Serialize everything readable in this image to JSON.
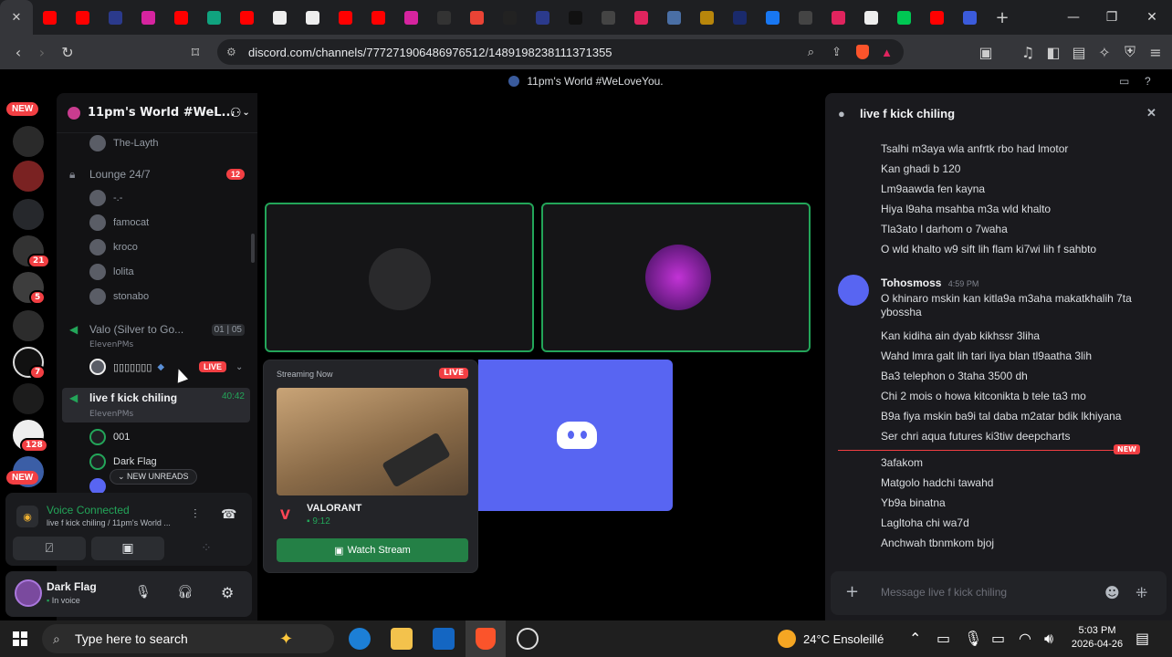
{
  "browser": {
    "url": "discord.com/channels/777271906486976512/1489198238111371355",
    "tab_count_icons": [
      "youtube-icon",
      "youtube-icon",
      "app-icon",
      "instagram-icon",
      "youtube-icon",
      "chatgpt-icon",
      "youtube-icon",
      "tiktok-icon",
      "play-icon",
      "youtube-icon",
      "youtube-icon",
      "instagram-icon",
      "app-icon",
      "gmail-icon",
      "app-icon",
      "app-icon",
      "x-icon",
      "app-icon",
      "app-icon",
      "app-icon",
      "app-icon",
      "app-icon",
      "facebook-icon",
      "app-icon",
      "app-icon",
      "app-icon",
      "app-icon",
      "youtube-icon",
      "app-icon"
    ]
  },
  "discord": {
    "window_title": "11pm's World #WeLoveYou.",
    "rail": {
      "new_top": "NEW",
      "new_bottom": "NEW",
      "badge_21": "21",
      "badge_5": "5",
      "badge_7": "7",
      "badge_128": "128"
    },
    "server_name": "11pm's World #WeL...",
    "channels": {
      "the_layth": "The-Layth",
      "lounge": "Lounge 24/7",
      "lounge_badge": "12",
      "lounge_members": [
        "-.-",
        "famocat",
        "kroco",
        "lolita",
        "stonabo"
      ],
      "valo": "Valo (Silver to Go...",
      "valo_count_a": "01",
      "valo_count_b": "05",
      "valo_sub": "ElevenPMs",
      "valo_member": "▯▯▯▯▯▯▯",
      "live_badge": "LIVE",
      "live_channel": "live f kick chiling",
      "live_time": "40:42",
      "live_sub": "ElevenPMs",
      "live_members": [
        "001",
        "Dark Flag"
      ],
      "new_unreads": "NEW UNREADS"
    },
    "voice": {
      "status": "Voice Connected",
      "detail": "live f kick chiling / 11pm's World ..."
    },
    "user": {
      "name": "Dark Flag",
      "status": "In voice"
    },
    "popup": {
      "header": "Streaming Now",
      "live": "LIVE",
      "game": "VALORANT",
      "time": "9:12",
      "button": "Watch Stream"
    },
    "chat": {
      "title": "live f kick chiling",
      "messages_a": [
        "Tsalhi m3aya wla anfrtk rbo had lmotor",
        "Kan ghadi b 120",
        "Lm9aawda fen kayna",
        "Hiya l9aha msahba m3a wld khalto",
        "Tla3ato l darhom o 7waha",
        "O wld khalto w9 sift lih flam ki7wi lih f sahbto"
      ],
      "author": "Tohosmoss",
      "time": "4:59 PM",
      "messages_b": [
        "O khinaro mskin kan kitla9a m3aha makatkhalih 7ta ybossha",
        "Kan kidiha ain dyab kikhssr 3liha",
        "Wahd lmra galt lih tari liya blan tl9aatha 3lih",
        "Ba3 telephon o 3taha 3500 dh",
        "Chi 2 mois o howa kitconikta b tele ta3 mo",
        "B9a fiya mskin ba9i tal daba m2atar bdik lkhiyana",
        "Ser chri aqua futures ki3tiw deepcharts"
      ],
      "new_marker": "NEW",
      "messages_c": [
        "3afakom",
        "Matgolo hadchi tawahd",
        "Yb9a binatna",
        "Lagltoha chi wa7d",
        "Anchwah tbnmkom bjoj"
      ],
      "placeholder": "Message live f kick chiling"
    }
  },
  "taskbar": {
    "search": "Type here to search",
    "weather": "24°C Ensoleillé",
    "time": "5:03 PM",
    "date": "2026-04-26"
  }
}
